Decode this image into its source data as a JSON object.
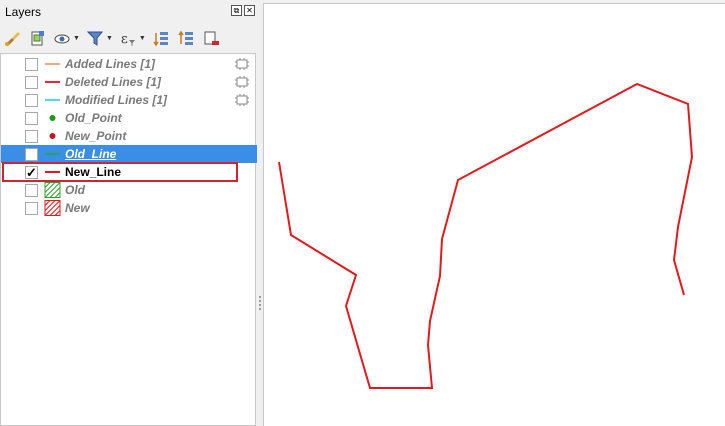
{
  "panel": {
    "title": "Layers",
    "float_label": "⧉",
    "close_label": "✕"
  },
  "toolbar": [
    {
      "name": "open-layer-styling-icon"
    },
    {
      "name": "add-group-icon"
    },
    {
      "name": "manage-visibility-icon"
    },
    {
      "name": "filter-legend-icon"
    },
    {
      "name": "filter-by-expression-icon"
    },
    {
      "name": "expand-all-icon"
    },
    {
      "name": "collapse-all-icon"
    },
    {
      "name": "remove-layer-icon"
    }
  ],
  "layers": [
    {
      "label": "Added Lines [1]",
      "checked": false,
      "symbol": "line",
      "color": "#f4a582",
      "embedded": true
    },
    {
      "label": "Deleted Lines [1]",
      "checked": false,
      "symbol": "line",
      "color": "#e8263a",
      "embedded": true
    },
    {
      "label": "Modified Lines [1]",
      "checked": false,
      "symbol": "line",
      "color": "#4dd9f0",
      "embedded": true
    },
    {
      "label": "Old_Point",
      "checked": false,
      "symbol": "point",
      "color": "#1a9c1a",
      "embedded": false
    },
    {
      "label": "New_Point",
      "checked": false,
      "symbol": "point",
      "color": "#c0161d",
      "embedded": false
    },
    {
      "label": "Old_Line",
      "checked": false,
      "symbol": "line",
      "color": "#2ca25f",
      "embedded": false,
      "selected": true
    },
    {
      "label": "New_Line",
      "checked": true,
      "check_mark": "✓",
      "symbol": "line",
      "color": "#e31a1c",
      "embedded": false,
      "active": true
    },
    {
      "label": "Old",
      "checked": false,
      "symbol": "polygon",
      "color": "#33a02c",
      "embedded": false
    },
    {
      "label": "New",
      "checked": false,
      "symbol": "polygon",
      "color": "#e31a1c",
      "embedded": false
    }
  ],
  "map": {
    "line_color": "#e31a1c",
    "feature": "New_Line"
  }
}
